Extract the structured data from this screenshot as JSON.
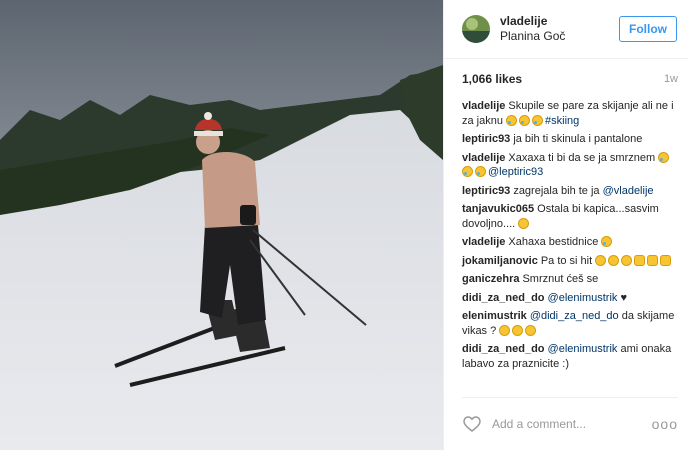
{
  "header": {
    "username": "vladelije",
    "location": "Planina Goč",
    "follow_label": "Follow"
  },
  "post": {
    "likes": "1,066 likes",
    "time": "1w"
  },
  "comments": [
    {
      "user": "vladelije",
      "text": "Skupile se pare za skijanje ali ne i za jaknu ",
      "emoji": [
        "tear",
        "tear",
        "tear"
      ],
      "tag": "#skiing"
    },
    {
      "user": "leptiric93",
      "text": "ja bih ti skinula i pantalone"
    },
    {
      "user": "vladelije",
      "text": "Xaxaxa ti bi da se ja smrznem ",
      "emoji": [
        "tear",
        "tear",
        "tear"
      ],
      "mention": "@leptiric93"
    },
    {
      "user": "leptiric93",
      "text": "zagrejala bih te ja ",
      "mention": "@vladelije"
    },
    {
      "user": "tanjavukic065",
      "text": "Ostala bi kapica...sasvim dovoljno.... ",
      "emoji": [
        "smile"
      ]
    },
    {
      "user": "vladelije",
      "text": "Xahaxa bestidnice ",
      "emoji": [
        "tear"
      ]
    },
    {
      "user": "jokamiljanovic",
      "text": "Pa to si hit ",
      "emoji": [
        "smile",
        "smile",
        "smile",
        "hand",
        "hand",
        "hand"
      ]
    },
    {
      "user": "ganiczehra",
      "text": "Smrznut ćeš se"
    },
    {
      "user": "didi_za_ned_do",
      "mention": "@elenimustrik",
      "text2": " ♥"
    },
    {
      "user": "elenimustrik",
      "mention": "@didi_za_ned_do",
      "text2": " da skijame vikas ? ",
      "emoji": [
        "smile",
        "smile",
        "smile"
      ]
    },
    {
      "user": "didi_za_ned_do",
      "mention": "@elenimustrik",
      "text2": " ami onaka labavo za praznicite :)"
    }
  ],
  "footer": {
    "placeholder": "Add a comment...",
    "more_label": "ooo"
  },
  "icons": {
    "like": "heart-icon",
    "more": "more-options-icon"
  },
  "colors": {
    "follow": "#3897f0",
    "mention": "#003569",
    "muted": "#999999"
  }
}
